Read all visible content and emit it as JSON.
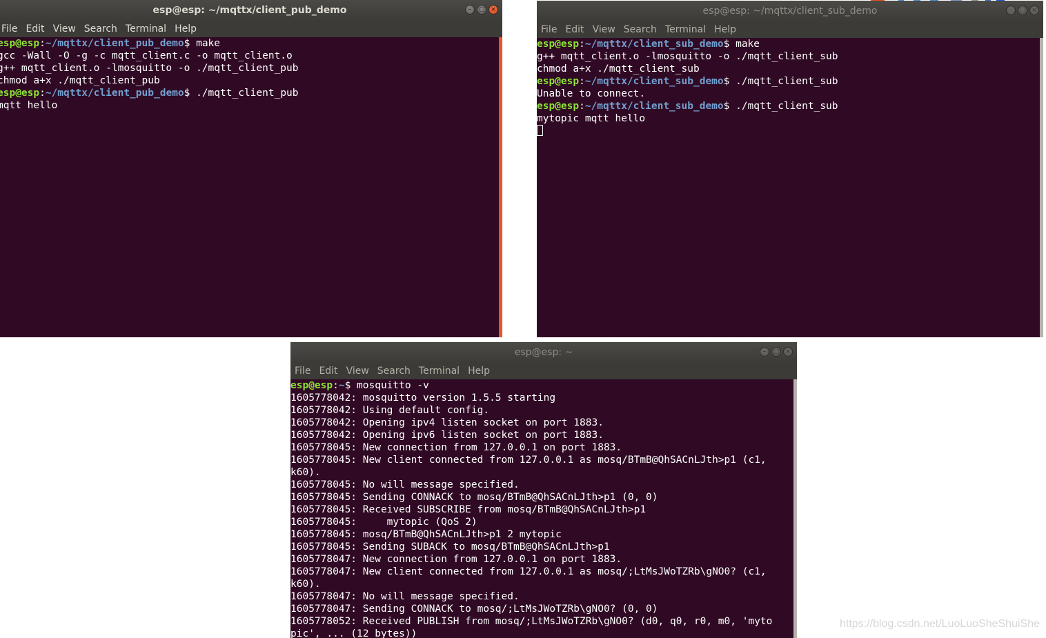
{
  "menu_items": [
    "File",
    "Edit",
    "View",
    "Search",
    "Terminal",
    "Help"
  ],
  "windows": {
    "pub": {
      "title": "esp@esp: ~/mqttx/client_pub_demo",
      "lines": [
        [
          {
            "t": "esp@esp",
            "c": "user"
          },
          {
            "t": ":"
          },
          {
            "t": "~/mqttx/client_pub_demo",
            "c": "path"
          },
          {
            "t": "$ make"
          }
        ],
        [
          {
            "t": "gcc -Wall -O -g -c mqtt_client.c -o mqtt_client.o"
          }
        ],
        [
          {
            "t": "g++ mqtt_client.o -lmosquitto -o ./mqtt_client_pub"
          }
        ],
        [
          {
            "t": "chmod a+x ./mqtt_client_pub"
          }
        ],
        [
          {
            "t": "esp@esp",
            "c": "user"
          },
          {
            "t": ":"
          },
          {
            "t": "~/mqttx/client_pub_demo",
            "c": "path"
          },
          {
            "t": "$ ./mqtt_client_pub"
          }
        ],
        [
          {
            "t": "mqtt hello"
          }
        ]
      ]
    },
    "sub": {
      "title": "esp@esp: ~/mqttx/client_sub_demo",
      "lines": [
        [
          {
            "t": "esp@esp",
            "c": "user"
          },
          {
            "t": ":"
          },
          {
            "t": "~/mqttx/client_sub_demo",
            "c": "path"
          },
          {
            "t": "$ make"
          }
        ],
        [
          {
            "t": "g++ mqtt_client.o -lmosquitto -o ./mqtt_client_sub"
          }
        ],
        [
          {
            "t": "chmod a+x ./mqtt_client_sub"
          }
        ],
        [
          {
            "t": "esp@esp",
            "c": "user"
          },
          {
            "t": ":"
          },
          {
            "t": "~/mqttx/client_sub_demo",
            "c": "path"
          },
          {
            "t": "$ ./mqtt_client_sub"
          }
        ],
        [
          {
            "t": "Unable to connect."
          }
        ],
        [
          {
            "t": "esp@esp",
            "c": "user"
          },
          {
            "t": ":"
          },
          {
            "t": "~/mqttx/client_sub_demo",
            "c": "path"
          },
          {
            "t": "$ ./mqtt_client_sub"
          }
        ],
        [
          {
            "t": "mytopic mqtt hello"
          }
        ],
        [
          {
            "t": "",
            "c": "cursor"
          }
        ]
      ]
    },
    "broker": {
      "title": "esp@esp: ~",
      "lines": [
        [
          {
            "t": "esp@esp",
            "c": "user"
          },
          {
            "t": ":"
          },
          {
            "t": "~",
            "c": "path"
          },
          {
            "t": "$ mosquitto -v"
          }
        ],
        [
          {
            "t": "1605778042: mosquitto version 1.5.5 starting"
          }
        ],
        [
          {
            "t": "1605778042: Using default config."
          }
        ],
        [
          {
            "t": "1605778042: Opening ipv4 listen socket on port 1883."
          }
        ],
        [
          {
            "t": "1605778042: Opening ipv6 listen socket on port 1883."
          }
        ],
        [
          {
            "t": "1605778045: New connection from 127.0.0.1 on port 1883."
          }
        ],
        [
          {
            "t": "1605778045: New client connected from 127.0.0.1 as mosq/BTmB@QhSACnLJth>p1 (c1,"
          }
        ],
        [
          {
            "t": "k60)."
          }
        ],
        [
          {
            "t": "1605778045: No will message specified."
          }
        ],
        [
          {
            "t": "1605778045: Sending CONNACK to mosq/BTmB@QhSACnLJth>p1 (0, 0)"
          }
        ],
        [
          {
            "t": "1605778045: Received SUBSCRIBE from mosq/BTmB@QhSACnLJth>p1"
          }
        ],
        [
          {
            "t": "1605778045:     mytopic (QoS 2)"
          }
        ],
        [
          {
            "t": "1605778045: mosq/BTmB@QhSACnLJth>p1 2 mytopic"
          }
        ],
        [
          {
            "t": "1605778045: Sending SUBACK to mosq/BTmB@QhSACnLJth>p1"
          }
        ],
        [
          {
            "t": "1605778047: New connection from 127.0.0.1 on port 1883."
          }
        ],
        [
          {
            "t": "1605778047: New client connected from 127.0.0.1 as mosq/;LtMsJWoTZRb\\gNO0? (c1,"
          }
        ],
        [
          {
            "t": "k60)."
          }
        ],
        [
          {
            "t": "1605778047: No will message specified."
          }
        ],
        [
          {
            "t": "1605778047: Sending CONNACK to mosq/;LtMsJWoTZRb\\gNO0? (0, 0)"
          }
        ],
        [
          {
            "t": "1605778052: Received PUBLISH from mosq/;LtMsJWoTZRb\\gNO0? (d0, q0, r0, m0, 'myto"
          }
        ],
        [
          {
            "t": "pic', ... (12 bytes))"
          }
        ]
      ]
    }
  },
  "watermark": "https://blog.csdn.net/LuoLuoSheShuiShe",
  "colors": {
    "terminal_bg": "#300a24",
    "prompt_user": "#8ae234",
    "prompt_path": "#729fcf",
    "accent": "#e95420"
  }
}
